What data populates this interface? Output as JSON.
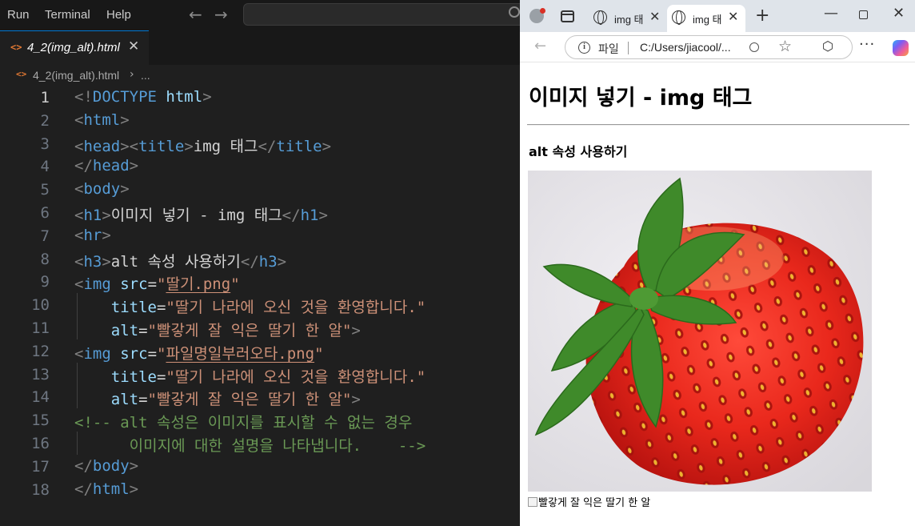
{
  "vscode": {
    "menu": [
      "Run",
      "Terminal",
      "Help"
    ],
    "tab": {
      "label": "4_2(img_alt).html",
      "icon": "<>"
    },
    "breadcrumb": {
      "file": "4_2(img_alt).html",
      "more": "..."
    },
    "current_line": 1,
    "lines": [
      [
        [
          "br",
          "<!"
        ],
        [
          "tag",
          "DOCTYPE"
        ],
        [
          "txt",
          " "
        ],
        [
          "doc",
          "html"
        ],
        [
          "br",
          ">"
        ]
      ],
      [
        [
          "br",
          "<"
        ],
        [
          "tag",
          "html"
        ],
        [
          "br",
          ">"
        ]
      ],
      [
        [
          "br",
          "<"
        ],
        [
          "tag",
          "head"
        ],
        [
          "br",
          "><"
        ],
        [
          "tag",
          "title"
        ],
        [
          "br",
          ">"
        ],
        [
          "txt",
          "img 태그"
        ],
        [
          "br",
          "</"
        ],
        [
          "tag",
          "title"
        ],
        [
          "br",
          ">"
        ]
      ],
      [
        [
          "br",
          "</"
        ],
        [
          "tag",
          "head"
        ],
        [
          "br",
          ">"
        ]
      ],
      [
        [
          "br",
          "<"
        ],
        [
          "tag",
          "body"
        ],
        [
          "br",
          ">"
        ]
      ],
      [
        [
          "br",
          "<"
        ],
        [
          "tag",
          "h1"
        ],
        [
          "br",
          ">"
        ],
        [
          "txt",
          "이미지 넣기 - img 태그"
        ],
        [
          "br",
          "</"
        ],
        [
          "tag",
          "h1"
        ],
        [
          "br",
          ">"
        ]
      ],
      [
        [
          "br",
          "<"
        ],
        [
          "tag",
          "hr"
        ],
        [
          "br",
          ">"
        ]
      ],
      [
        [
          "br",
          "<"
        ],
        [
          "tag",
          "h3"
        ],
        [
          "br",
          ">"
        ],
        [
          "txt",
          "alt 속성 사용하기"
        ],
        [
          "br",
          "</"
        ],
        [
          "tag",
          "h3"
        ],
        [
          "br",
          ">"
        ]
      ],
      [
        [
          "br",
          "<"
        ],
        [
          "tag",
          "img"
        ],
        [
          "txt",
          " "
        ],
        [
          "attr",
          "src"
        ],
        [
          "txt",
          "="
        ],
        [
          "str",
          "\""
        ],
        [
          "link",
          "딸기.png"
        ],
        [
          "str",
          "\""
        ]
      ],
      [
        [
          "txt",
          "    "
        ],
        [
          "attr",
          "title"
        ],
        [
          "txt",
          "="
        ],
        [
          "str",
          "\"딸기 나라에 오신 것을 환영합니다.\""
        ]
      ],
      [
        [
          "txt",
          "    "
        ],
        [
          "attr",
          "alt"
        ],
        [
          "txt",
          "="
        ],
        [
          "str",
          "\"빨갛게 잘 익은 딸기 한 알\""
        ],
        [
          "br",
          ">"
        ]
      ],
      [
        [
          "br",
          "<"
        ],
        [
          "tag",
          "img"
        ],
        [
          "txt",
          " "
        ],
        [
          "attr",
          "src"
        ],
        [
          "txt",
          "="
        ],
        [
          "str",
          "\""
        ],
        [
          "link",
          "파일명일부러오타.png"
        ],
        [
          "str",
          "\""
        ]
      ],
      [
        [
          "txt",
          "    "
        ],
        [
          "attr",
          "title"
        ],
        [
          "txt",
          "="
        ],
        [
          "str",
          "\"딸기 나라에 오신 것을 환영합니다.\""
        ]
      ],
      [
        [
          "txt",
          "    "
        ],
        [
          "attr",
          "alt"
        ],
        [
          "txt",
          "="
        ],
        [
          "str",
          "\"빨갛게 잘 익은 딸기 한 알\""
        ],
        [
          "br",
          ">"
        ]
      ],
      [
        [
          "cm",
          "<!-- alt 속성은 이미지를 표시할 수 없는 경우"
        ]
      ],
      [
        [
          "cm",
          "      이미지에 대한 설명을 나타냅니다.    -->"
        ]
      ],
      [
        [
          "br",
          "</"
        ],
        [
          "tag",
          "body"
        ],
        [
          "br",
          ">"
        ]
      ],
      [
        [
          "br",
          "</"
        ],
        [
          "tag",
          "html"
        ],
        [
          "br",
          ">"
        ]
      ]
    ]
  },
  "browser": {
    "tabs": [
      {
        "title": "img 태",
        "active": false
      },
      {
        "title": "img 태",
        "active": true
      }
    ],
    "address": {
      "scheme": "파일",
      "url": "C:/Users/jiacool/..."
    },
    "page": {
      "h1": "이미지 넣기 - img 태그",
      "h3": "alt 속성 사용하기",
      "broken_image_alt": "빨갛게 잘 익은 딸기 한 알"
    }
  },
  "colors": {
    "editor_bg": "#1f1f1f",
    "tag": "#569cd6",
    "attribute": "#9cdcfe",
    "string": "#ce9178",
    "comment": "#6a9955",
    "bracket": "#808080"
  }
}
